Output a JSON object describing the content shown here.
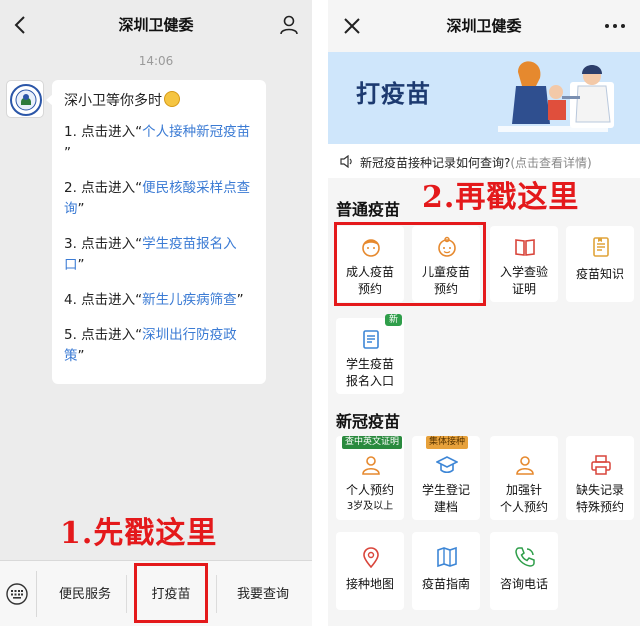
{
  "chat": {
    "title": "深圳卫健委",
    "time": "14:06",
    "greeting": "深小卫等你多时",
    "items": [
      {
        "prefix": "1. 点击进入“",
        "link": "个人接种新冠疫苗",
        "suffix": "”"
      },
      {
        "prefix": "2. 点击进入“",
        "link": "便民核酸采样点查询",
        "suffix": "”"
      },
      {
        "prefix": "3. 点击进入“",
        "link": "学生疫苗报名入口",
        "suffix": "”"
      },
      {
        "prefix": "4. 点击进入“",
        "link": "新生儿疾病筛查",
        "suffix": "”"
      },
      {
        "prefix": "5. 点击进入“",
        "link": "深圳出行防疫政策",
        "suffix": "”"
      }
    ],
    "menu": [
      "便民服务",
      "打疫苗",
      "我要查询"
    ],
    "annotation": "1.先戳这里"
  },
  "app": {
    "title": "深圳卫健委",
    "banner_title": "打疫苗",
    "notice_text": "新冠疫苗接种记录如何查询?",
    "notice_hint": "(点击查看详情)",
    "annotation": "2.再戳这里",
    "sections": {
      "regular": "普通疫苗",
      "covid": "新冠疫苗"
    },
    "regular_tiles": [
      {
        "line1": "成人疫苗",
        "line2": "预约",
        "icon": "adult-face-icon"
      },
      {
        "line1": "儿童疫苗",
        "line2": "预约",
        "icon": "child-face-icon"
      },
      {
        "line1": "入学查验",
        "line2": "证明",
        "icon": "open-book-icon"
      },
      {
        "line1": "疫苗知识",
        "line2": "",
        "icon": "document-icon"
      },
      {
        "line1": "学生疫苗",
        "line2": "报名入口",
        "icon": "clipboard-icon",
        "badge": "新"
      }
    ],
    "covid_tiles": [
      {
        "line1": "个人预约",
        "line2": "3岁及以上",
        "icon": "person-icon",
        "tag": "查中英文证明"
      },
      {
        "line1": "学生登记",
        "line2": "建档",
        "icon": "graduation-cap-icon",
        "tag": "集体接种"
      },
      {
        "line1": "加强针",
        "line2": "个人预约",
        "icon": "person-icon"
      },
      {
        "line1": "缺失记录",
        "line2": "特殊预约",
        "icon": "printer-icon"
      },
      {
        "line1": "接种地图",
        "line2": "",
        "icon": "map-pin-icon"
      },
      {
        "line1": "疫苗指南",
        "line2": "",
        "icon": "map-book-icon"
      },
      {
        "line1": "咨询电话",
        "line2": "",
        "icon": "phone-icon"
      }
    ]
  },
  "colors": {
    "link": "#3b7bd4",
    "annotation_red": "#e4191b",
    "icon_orange": "#e6892e",
    "banner_bg": "#cfe6fb"
  }
}
